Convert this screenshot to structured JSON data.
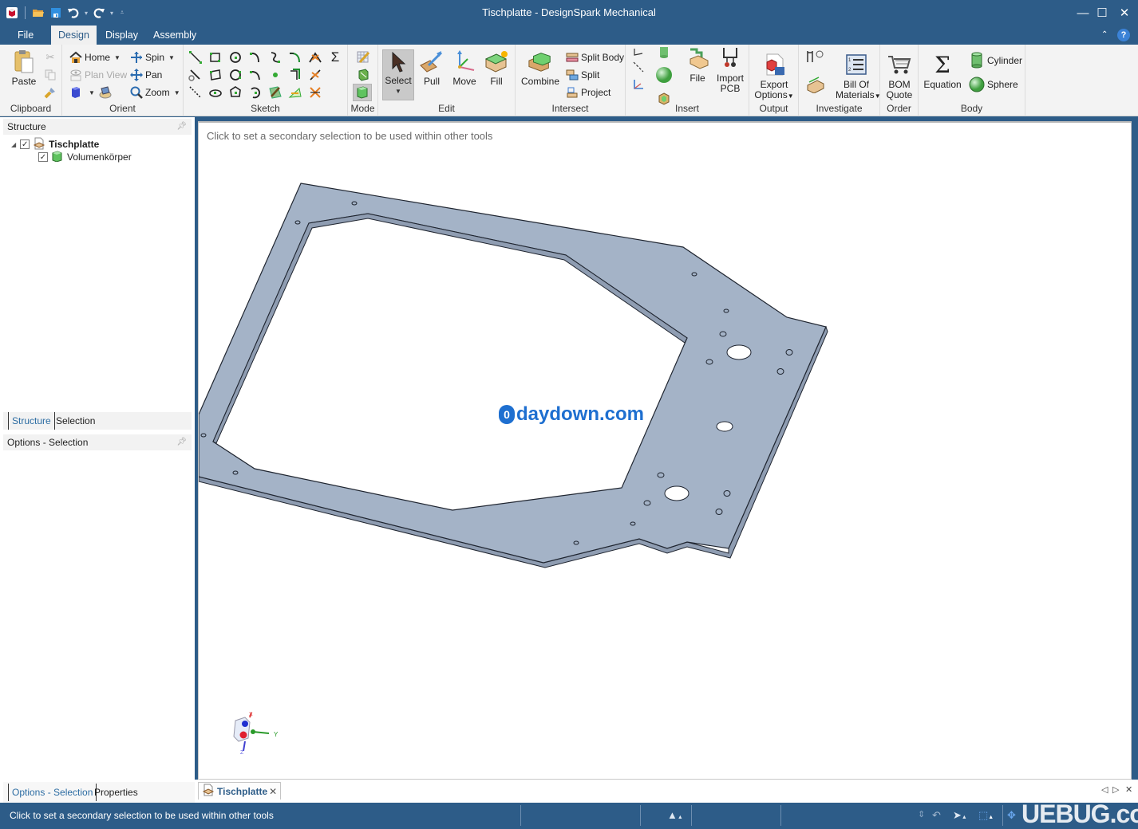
{
  "window": {
    "title": "Tischplatte - DesignSpark Mechanical",
    "controls": {
      "minimize": "—",
      "maximize": "☐",
      "close": "✕"
    }
  },
  "quick_access": [
    {
      "name": "app-logo-icon"
    },
    {
      "name": "open-folder-icon"
    },
    {
      "name": "save-icon"
    },
    {
      "name": "undo-icon"
    },
    {
      "name": "redo-icon"
    },
    {
      "name": "customize-icon"
    }
  ],
  "menu_tabs": [
    {
      "label": "File",
      "active": false
    },
    {
      "label": "Design",
      "active": true
    },
    {
      "label": "Display",
      "active": false
    },
    {
      "label": "Assembly",
      "active": false
    }
  ],
  "ribbon": {
    "clipboard": {
      "label": "Clipboard",
      "paste": "Paste"
    },
    "orient": {
      "label": "Orient",
      "home": "Home",
      "plan_view": "Plan View",
      "spin": "Spin",
      "pan": "Pan",
      "zoom": "Zoom"
    },
    "sketch": {
      "label": "Sketch"
    },
    "mode": {
      "label": "Mode"
    },
    "edit": {
      "label": "Edit",
      "select": "Select",
      "pull": "Pull",
      "move": "Move",
      "fill": "Fill"
    },
    "intersect": {
      "label": "Intersect",
      "combine": "Combine",
      "split_body": "Split Body",
      "split": "Split",
      "project": "Project"
    },
    "insert": {
      "label": "Insert",
      "file": "File",
      "import_pcb_1": "Import",
      "import_pcb_2": "PCB"
    },
    "output": {
      "label": "Output",
      "export_1": "Export",
      "export_2": "Options"
    },
    "investigate": {
      "label": "Investigate",
      "bom_1": "Bill Of",
      "bom_2": "Materials"
    },
    "order": {
      "label": "Order",
      "quote_1": "BOM",
      "quote_2": "Quote"
    },
    "body": {
      "label": "Body",
      "equation": "Equation",
      "cylinder": "Cylinder",
      "sphere": "Sphere"
    }
  },
  "structure_panel": {
    "title": "Structure",
    "tree": [
      {
        "label": "Tischplatte",
        "checked": true,
        "bold": true,
        "level": 0
      },
      {
        "label": "Volumenkörper",
        "checked": true,
        "bold": false,
        "level": 1
      }
    ],
    "tabs": [
      {
        "label": "Structure"
      },
      {
        "label": "Selection"
      }
    ]
  },
  "options_panel": {
    "title": "Options - Selection",
    "tabs": [
      {
        "label": "Options - Selection"
      },
      {
        "label": "Properties"
      }
    ]
  },
  "viewport": {
    "hint": "Click to set a secondary selection to be used within other tools",
    "watermark": "daydown.com",
    "triad": {
      "x": "X",
      "y": "Y",
      "z": "Z"
    },
    "colors": {
      "plate": "#a4b3c7",
      "edge": "#1f2530",
      "side": "#8f9db2"
    }
  },
  "document_tabs": [
    {
      "label": "Tischplatte",
      "close": "✕"
    }
  ],
  "doc_nav": {
    "prev": "◁",
    "next": "▷",
    "close": "✕"
  },
  "status": {
    "text": "Click to set a secondary selection to be used within other tools",
    "watermark": "UEBUG.com"
  }
}
